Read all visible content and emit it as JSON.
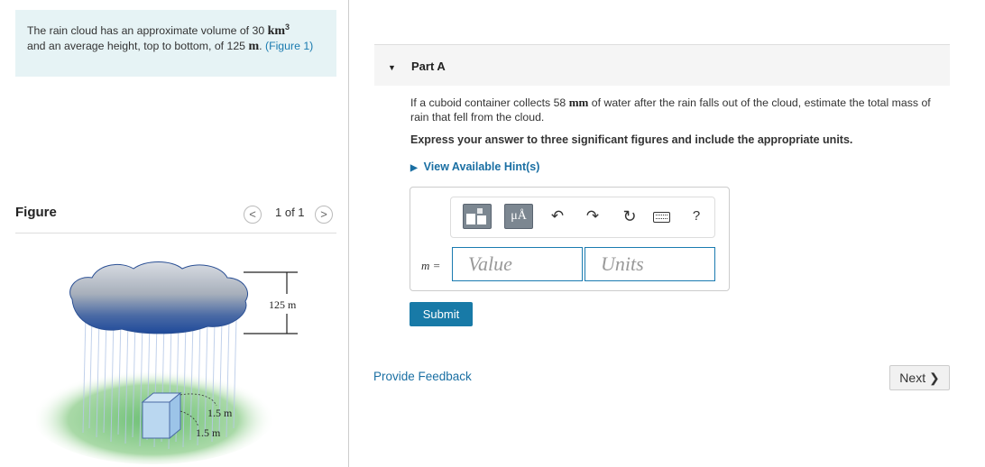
{
  "problem": {
    "text_before": "The rain cloud has an approximate volume of 30",
    "volume_unit": "km",
    "volume_unit_exp": "3",
    "text_middle": "and an average height, top to bottom, of 125",
    "height_unit": "m",
    "figure_link": "(Figure 1)"
  },
  "figure": {
    "label": "Figure",
    "nav_text": "1 of 1",
    "prev_glyph": "<",
    "next_glyph": ">",
    "height_label": "125 m",
    "box_width_label": "1.5 m",
    "box_depth_label": "1.5 m"
  },
  "part": {
    "title": "Part A",
    "question_before": "If a cuboid container collects 58",
    "question_unit": "mm",
    "question_after": "of water after the rain falls out of the cloud, estimate the total mass of rain that fell from the cloud.",
    "instructions": "Express your answer to three significant figures and include the appropriate units.",
    "hint_link": "View Available Hint(s)"
  },
  "answer": {
    "variable_label": "m =",
    "value_placeholder": "Value",
    "units_placeholder": "Units",
    "submit_label": "Submit"
  },
  "toolbar": {
    "units_button_label": "μÅ",
    "help_label": "?"
  },
  "footer": {
    "feedback_link": "Provide Feedback",
    "next_label": "Next ❯"
  }
}
